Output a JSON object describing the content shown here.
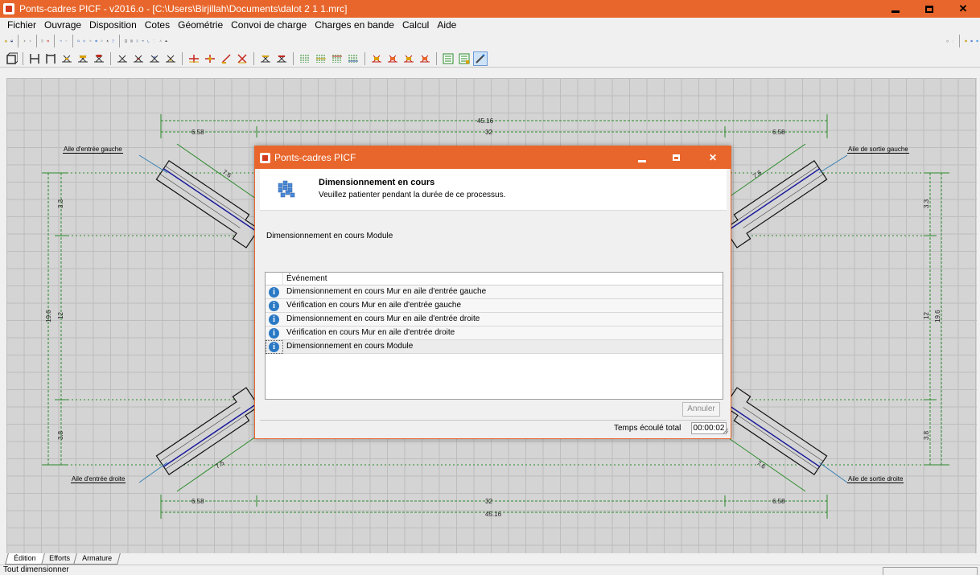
{
  "window": {
    "title": "Ponts-cadres PICF - v2016.o - [C:\\Users\\Birjillah\\Documents\\dalot 2 1 1.mrc]"
  },
  "menu": [
    "Fichier",
    "Ouvrage",
    "Disposition",
    "Cotes",
    "Géométrie",
    "Convoi de charge",
    "Charges en bande",
    "Calcul",
    "Aide"
  ],
  "drawing": {
    "wing_labels": {
      "entree_gauche": "Aile d'entrée gauche",
      "entree_droite": "Aile d'entrée droite",
      "sortie_gauche": "Aile de sortie gauche",
      "sortie_droite": "Aile de sortie droite"
    },
    "dims": {
      "top_total": "45.16",
      "top_mid": "32",
      "left_seg": "6.58",
      "right_seg": "6.58",
      "bottom_total": "45.16",
      "bottom_mid": "32",
      "bottom_left": "6.58",
      "bottom_right": "6.58",
      "left_top": "3.3",
      "left_mid": "12",
      "left_total": "19.6",
      "left_bottom": "3.8",
      "right_top": "3.3",
      "right_mid": "12",
      "right_total": "19.6",
      "right_bottom": "3.8",
      "wing_tl": "7.6",
      "wing_tr": "7.6",
      "wing_bl": "7.5",
      "wing_br": "7.6"
    }
  },
  "tabs": [
    "Édition",
    "Efforts",
    "Armature"
  ],
  "status": {
    "text": "Tout dimensionner"
  },
  "dialog": {
    "title": "Ponts-cadres PICF",
    "heading": "Dimensionnement en cours",
    "subheading": "Veuillez patienter pendant la durée de ce processus.",
    "message": "Dimensionnement en cours Module",
    "column_header": "Événement",
    "events": [
      "Dimensionnement en cours Mur en aile d'entrée gauche",
      "Vérification en cours Mur en aile d'entrée gauche",
      "Dimensionnement en cours Mur en aile d'entrée droite",
      "Vérification en cours Mur en aile d'entrée droite",
      "Dimensionnement en cours Module"
    ],
    "cancel_label": "Annuler",
    "elapsed_label": "Temps écoulé total",
    "elapsed_value": "00:00:02"
  },
  "colors": {
    "accent": "#e8662b",
    "dim_line": "#2a8a2a",
    "wall_axis": "#1a1a9a",
    "info_icon": "#2a79c4"
  }
}
